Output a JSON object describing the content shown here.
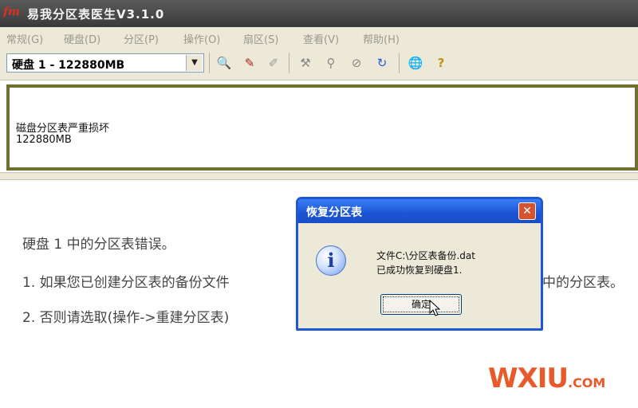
{
  "window": {
    "title": "易我分区表医生V3.1.0",
    "icon_text": "fm"
  },
  "menu": [
    "常规(G)",
    "硬盘(D)",
    "分区(P)",
    "操作(O)",
    "扇区(S)",
    "查看(V)",
    "帮助(H)"
  ],
  "toolbar": {
    "disk_select_value": "硬盘 1 - 122880MB"
  },
  "partition_panel": {
    "status": "磁盘分区表严重损坏",
    "size": "122880MB"
  },
  "messages": {
    "line1": "硬盘 1 中的分区表错误。",
    "line2a": "1. 如果您已创建分区表的备份文件",
    "line2b": "中的分区表。",
    "line3": "2. 否则请选取(操作->重建分区表)"
  },
  "dialog": {
    "title": "恢复分区表",
    "close_label": "✕",
    "icon_letter": "i",
    "line1": "文件C:\\分区表备份.dat",
    "line2": "已成功恢复到硬盘1.",
    "ok_label": "确定"
  },
  "watermark": {
    "brand": "WXIU",
    "suffix": ".COM"
  },
  "colors": {
    "titlebar": "#4a4a4a",
    "dialog_title": "#1b54d4",
    "panel_border": "#707030",
    "logo": "#e85a2a"
  }
}
